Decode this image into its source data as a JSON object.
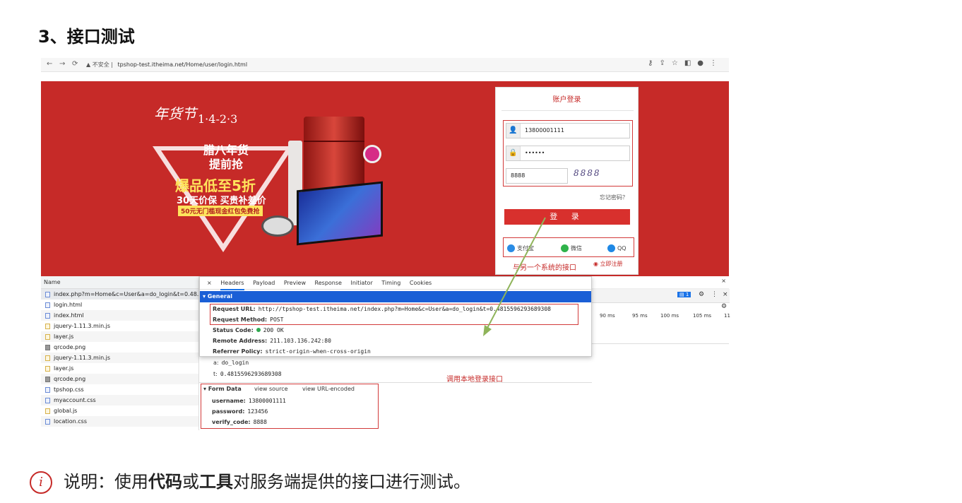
{
  "heading": "3、接口测试",
  "browser": {
    "insecure_label": "不安全",
    "url": "tpshop-test.itheima.net/Home/user/login.html"
  },
  "banner": {
    "brand": "年货节",
    "dates": "1·4-2·3",
    "promo_line1": "腊八年货",
    "promo_line2": "提前抢",
    "promo_big": "爆品低至5折",
    "promo_sub": "30天价保 买贵补差价",
    "promo_tag": "50元无门槛现金红包免费抢"
  },
  "login": {
    "title": "账户登录",
    "username": "13800001111",
    "password_mask": "••••••",
    "verify_code": "8888",
    "captcha_text": "8888",
    "forgot": "忘记密码？",
    "submit": "登 录",
    "alipay": "支付宝",
    "wechat": "微信",
    "qq": "QQ",
    "register": "立即注册",
    "note_other": "与另一个系统的接口"
  },
  "network": {
    "name_header": "Name",
    "rows": [
      "index.php?m=Home&c=User&a=do_login&t=0.48...",
      "login.html",
      "index.html",
      "jquery-1.11.3.min.js",
      "layer.js",
      "qrcode.png",
      "jquery-1.11.3.min.js",
      "layer.js",
      "qrcode.png",
      "tpshop.css",
      "myaccount.css",
      "global.js",
      "location.css"
    ]
  },
  "devtools": {
    "tabs": [
      "Headers",
      "Payload",
      "Preview",
      "Response",
      "Initiator",
      "Timing",
      "Cookies"
    ],
    "general_label": "▾ General",
    "request_url_key": "Request URL:",
    "request_url": "http://tpshop-test.itheima.net/index.php?m=Home&c=User&a=do_login&t=0.4815596293689308",
    "method_key": "Request Method:",
    "method": "POST",
    "status_key": "Status Code:",
    "status": "200 OK",
    "remote_key": "Remote Address:",
    "remote": "211.103.136.242:80",
    "referrer_key": "Referrer Policy:",
    "referrer": "strict-origin-when-cross-origin",
    "query_a_key": "a:",
    "query_a": "do_login",
    "query_t_key": "t:",
    "query_t": "0.4815596293689308",
    "form_label": "▾ Form Data",
    "view_source": "view source",
    "view_url": "view URL-encoded",
    "username_key": "username:",
    "username": "13800001111",
    "password_key": "password:",
    "password": "123456",
    "verify_key": "verify_code:",
    "verify": "8888",
    "note_local": "调用本地登录接口",
    "timing_ticks": [
      "90 ms",
      "95 ms",
      "100 ms",
      "105 ms",
      "11"
    ],
    "badge": "1"
  },
  "footer": {
    "prefix": "说明：使用",
    "bold1": "代码",
    "mid": "或",
    "bold2": "工具",
    "suffix": "对服务端提供的接口进行测试。"
  }
}
